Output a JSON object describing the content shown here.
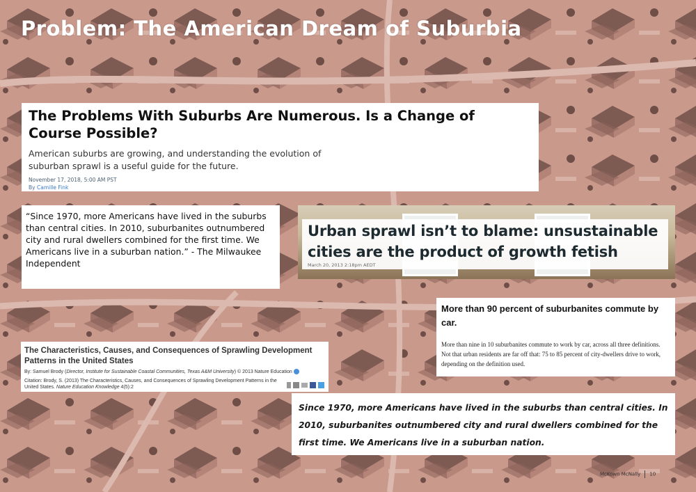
{
  "slide_title": "Problem: The American Dream of Suburbia",
  "article1": {
    "headline": "The Problems With Suburbs Are Numerous. Is a Change of Course Possible?",
    "subheadline": "American suburbs are growing, and understanding the evolution of suburban sprawl is a useful guide for the future.",
    "date": "November 17, 2018, 5:00 AM PST",
    "by_prefix": "By",
    "author": "Camille Fink"
  },
  "quote1": {
    "text": "“Since 1970, more Americans have lived in the suburbs than central cities. In 2010, suburbanites outnumbered city and rural dwellers combined for the first time. We Americans live in a suburban nation.” - The Milwaukee Independent"
  },
  "article2": {
    "headline": "Urban sprawl isn’t to blame: unsustainable cities are the product of growth fetish",
    "date": "March 20, 2013 2:18pm AEDT"
  },
  "stat_card": {
    "headline": "More than 90 percent of suburbanites commute by car.",
    "body": "More than nine in 10 suburbanites commute to work by car, across all three definitions. Not that urban residents are far off that: 75 to 85 percent of city-dwellers drive to work, depending on the definition used."
  },
  "paper": {
    "title": "The Characteristics, Causes, and Consequences of Sprawling Development Patterns in the United States",
    "by_line_a": "By: Samuel Brody (",
    "by_line_affil": "Director, Institute for Sustainable Coastal Communities, Texas A&M University",
    "by_line_b": ") © 2013 Nature Education",
    "citation_a": "Citation: Brody, S. (2013) The Characteristics, Causes, and Consequences of Sprawling Development Patterns in the United States.",
    "citation_journal": "Nature Education Knowledge",
    "citation_b": "4(5):2"
  },
  "quote2": {
    "text": "Since 1970, more Americans have lived in the suburbs than central cities. In 2010, suburbanites outnumbered city and rural dwellers combined for the first time. We Americans live in a suburban nation."
  },
  "footer": {
    "author": "McKown McNally",
    "page": "10"
  }
}
